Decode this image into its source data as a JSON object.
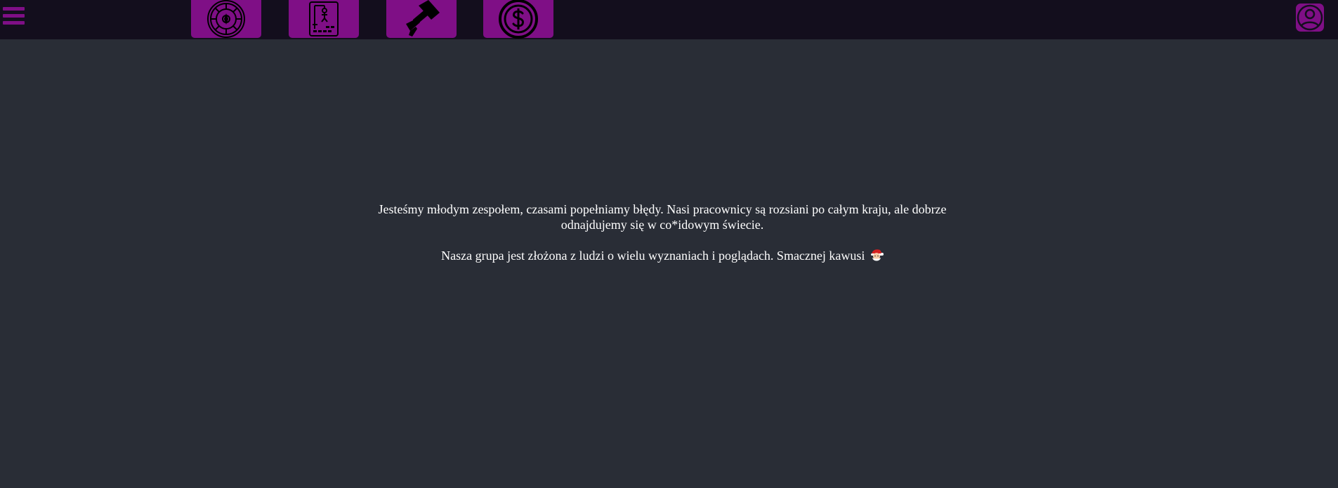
{
  "topbar": {
    "background": "#130e1d",
    "accent": "#7f0f86",
    "menu_icon": "hamburger-icon",
    "nav_items": [
      {
        "name": "roulette",
        "icon": "roulette-icon"
      },
      {
        "name": "hangman",
        "icon": "hangman-icon"
      },
      {
        "name": "hammer",
        "icon": "hammer-icon"
      },
      {
        "name": "coin",
        "icon": "dollar-coin-icon"
      }
    ],
    "profile_icon": "user-avatar-icon"
  },
  "main": {
    "background": "#292d36",
    "paragraph_1": "Jesteśmy młodym zespołem, czasami popełniamy błędy. Nasi pracownicy są rozsiani po całym kraju, ale dobrze odnajdujemy się w co*idowym świecie.",
    "paragraph_2": "Nasza grupa jest złożona z ludzi o wielu wyznaniach i poglądach. Smacznej kawusi",
    "emoji": "santa-emoji"
  }
}
